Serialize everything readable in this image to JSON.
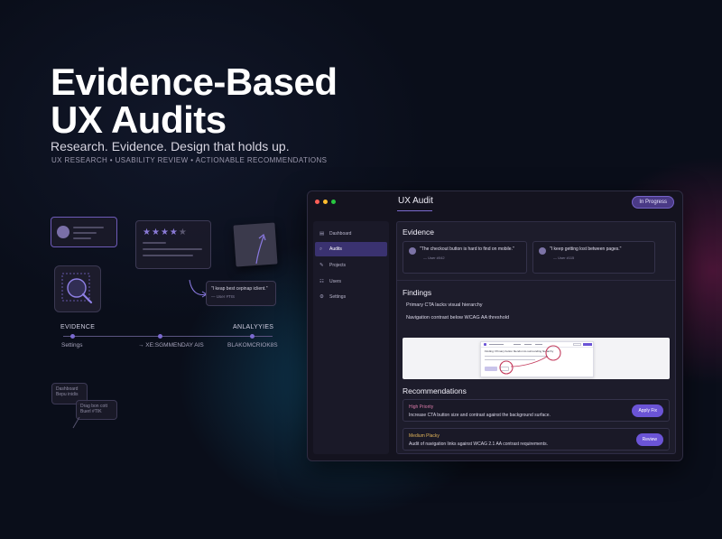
{
  "hero": {
    "title_line1": "Evidence-Based",
    "title_line2": "UX Audits",
    "subtitle": "Research. Evidence. Design that holds up.",
    "tags": "UX RESEARCH • USABILITY REVIEW • ACTIONABLE RECOMMENDATIONS"
  },
  "decor": {
    "quote_text": "\"I keap best cepinap iclient.\"",
    "quote_user": "— User #TIS",
    "rating_stars": 4,
    "rating_max": 5,
    "timeline": {
      "label_left": "EVIDENCE",
      "label_right": "ANLALYYIES",
      "sub_left": "Settings",
      "sub_mid": "→ XE:SGMMENDAY AIS",
      "sub_right": "BLAKOMCRIOK8S"
    },
    "tooltip1_line1": "Dashboard",
    "tooltip1_line2": "Bepu inidis",
    "tooltip2_line1": "Drag bon cott",
    "tooltip2_line2": "Buerl #TIK"
  },
  "window": {
    "title": "UX Audit",
    "status": "In Progress",
    "colors": {
      "accent": "#6b54d6",
      "close": "#ff5f57",
      "minimize": "#febc2e",
      "maximize": "#28c840"
    },
    "nav": [
      {
        "icon": "dashboard-icon",
        "glyph": "▤",
        "label": "Dashboard",
        "active": false
      },
      {
        "icon": "search-icon",
        "glyph": "⌕",
        "label": "Audits",
        "active": true
      },
      {
        "icon": "pencil-icon",
        "glyph": "✎",
        "label": "Projects",
        "active": false
      },
      {
        "icon": "users-icon",
        "glyph": "☷",
        "label": "Users",
        "active": false
      },
      {
        "icon": "gear-icon",
        "glyph": "⚙",
        "label": "Settings",
        "active": false
      }
    ],
    "evidence": {
      "heading": "Evidence",
      "cards": [
        {
          "quote": "\"The checkout button is hard to find on mobile.\"",
          "user": "— User #042"
        },
        {
          "quote": "\"I keep getting lost between pages.\"",
          "user": "— User #115"
        }
      ]
    },
    "findings": {
      "heading": "Findings",
      "items": [
        "Primary CTA lacks visual hierarchy",
        "Navigation contrast below WCAG AA threshold"
      ],
      "preview_heading": "Finding: Primary button blends into surrounding hierarchy"
    },
    "recommendations": {
      "heading": "Recommendations",
      "items": [
        {
          "priority": "High Priority",
          "priority_color": "#d97aa8",
          "text": "Increase CTA button size and contrast against the background surface.",
          "action": "Apply Fix"
        },
        {
          "priority": "Medium Placky",
          "priority_color": "#e0b45a",
          "text": "Audit of navigation links against WCAG 2.1 AA contrast requirements.",
          "action": "Review"
        }
      ]
    }
  }
}
